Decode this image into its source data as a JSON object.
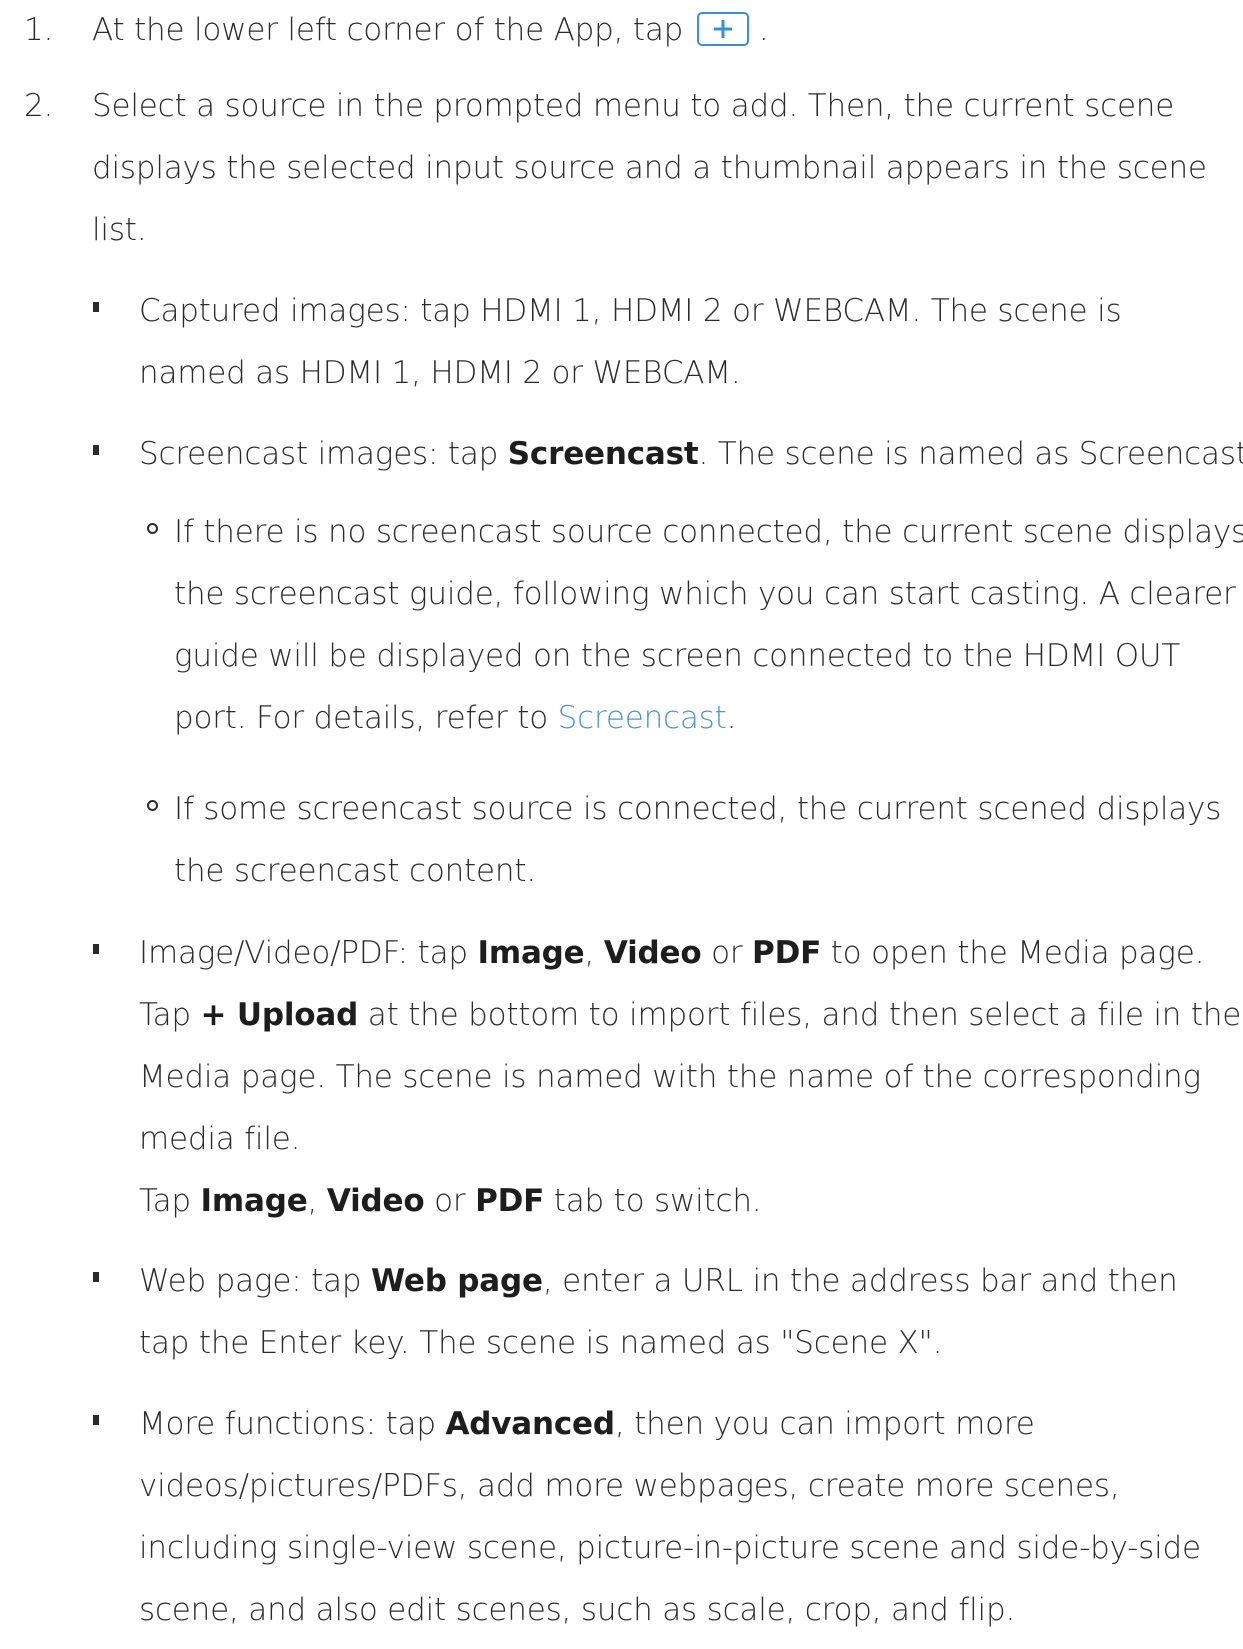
{
  "steps": [
    {
      "number": "1.",
      "text_before": "At the lower left corner of the App, tap",
      "text_after": "."
    },
    {
      "number": "2.",
      "lines": [
        "Select a source in the prompted menu to add. Then, the current scene",
        "displays the selected input source and a thumbnail appears in the scene",
        "list."
      ]
    }
  ],
  "captured": {
    "line1": "Captured images: tap HDMI 1, HDMI 2 or WEBCAM. The scene is",
    "line2": "named as HDMI 1, HDMI 2 or WEBCAM."
  },
  "screencast": {
    "pre": "Screencast images: tap ",
    "bold": "Screencast",
    "post": ". The scene is named as Screencast.",
    "sub1": {
      "line1": "If there is no screencast source connected, the current scene displays",
      "line2": "the screencast guide, following which you can start casting. A clearer",
      "line3": "guide will be displayed on the screen connected to the HDMI OUT",
      "line4_pre": "port. For details, refer to ",
      "link": "Screencast",
      "line4_post": "."
    },
    "sub2": {
      "line1": "If some screencast source is connected, the current scened displays",
      "line2": "the screencast content."
    }
  },
  "media": {
    "l1_pre": "Image/Video/PDF: tap ",
    "image": "Image",
    "comma": ", ",
    "video": "Video",
    "or": " or ",
    "pdf": "PDF",
    "l1_post": " to open the Media page.",
    "l2_pre": "Tap ",
    "upload": "+ Upload",
    "l2_post": " at the bottom to import files, and then select a file in the",
    "l3": "Media page. The scene is named with the name of the corresponding",
    "l4": "media file.",
    "l5_pre": "Tap ",
    "l5_post": " tab to switch."
  },
  "webpage": {
    "pre": "Web page: tap ",
    "bold": "Web page",
    "post": ", enter a URL in the address bar and then",
    "line2": "tap the Enter key. The scene is named as \"Scene X\"."
  },
  "advanced": {
    "pre": "More functions: tap ",
    "bold": "Advanced",
    "post": ", then you can import more",
    "line2": "videos/pictures/PDFs, add more webpages, create more scenes,",
    "line3": "including single-view scene, picture-in-picture scene and side-by-side",
    "line4": "scene, and also edit scenes, such as scale, crop, and flip."
  }
}
